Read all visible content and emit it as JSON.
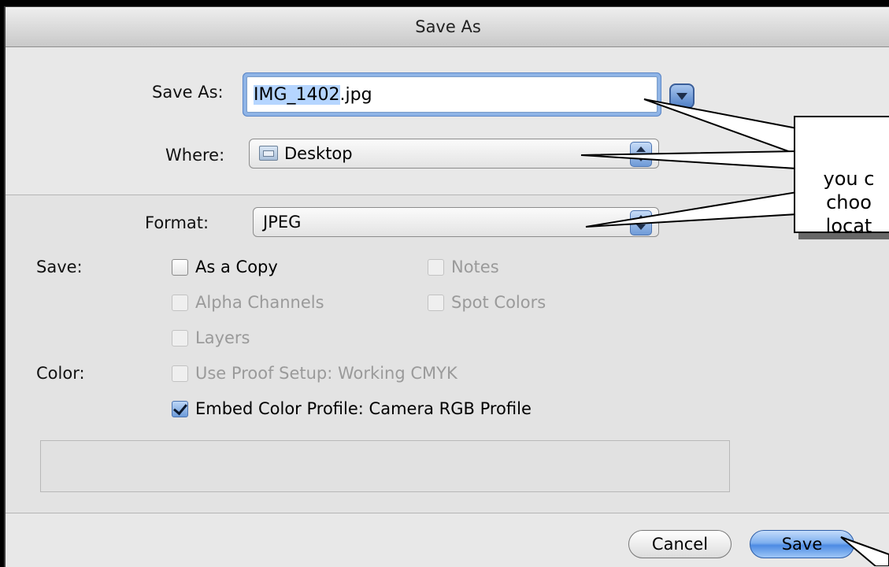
{
  "window": {
    "title": "Save As"
  },
  "save_as": {
    "label": "Save As:",
    "filename_selected": "IMG_1402",
    "filename_ext": ".jpg"
  },
  "where": {
    "label": "Where:",
    "value": "Desktop"
  },
  "format": {
    "label": "Format:",
    "value": "JPEG"
  },
  "save_options": {
    "label": "Save:",
    "as_a_copy": "As a Copy",
    "notes": "Notes",
    "alpha_channels": "Alpha Channels",
    "spot_colors": "Spot Colors",
    "layers": "Layers"
  },
  "color_options": {
    "label": "Color:",
    "use_proof_setup": "Use Proof Setup:  Working CMYK",
    "embed_color_profile": "Embed Color Profile:  Camera RGB Profile"
  },
  "buttons": {
    "cancel": "Cancel",
    "save": "Save"
  },
  "callout": {
    "line1": "you c",
    "line2": "choo",
    "line3": "locat"
  }
}
